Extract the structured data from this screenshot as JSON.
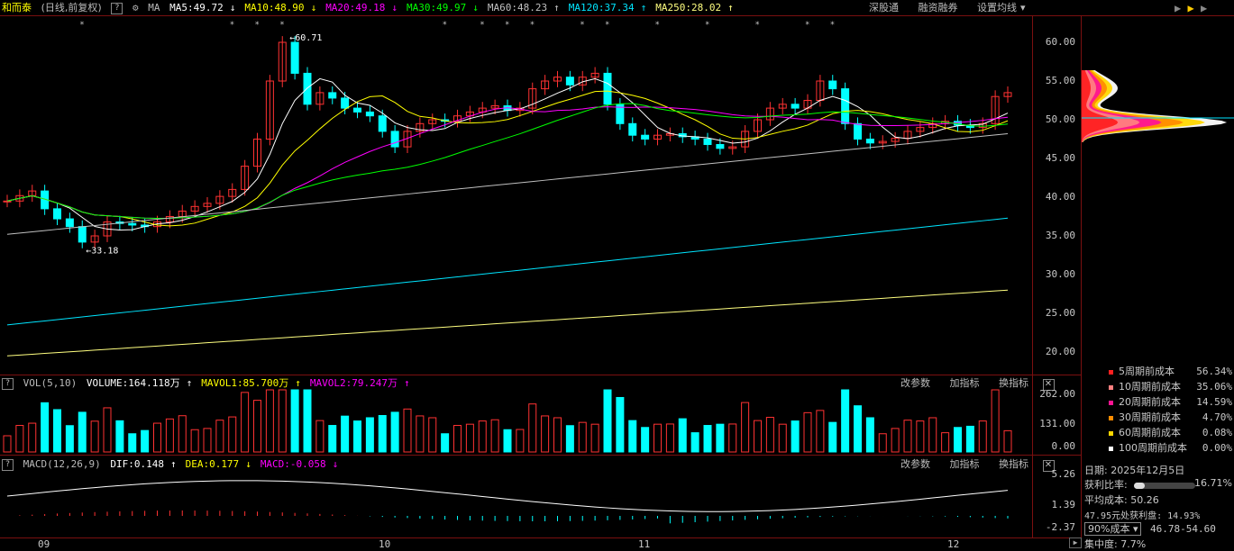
{
  "stock": {
    "name": "和而泰",
    "mode": "(日线,前复权)",
    "help": "?",
    "ma_label": "MA"
  },
  "ma_items": [
    {
      "label": "MA5:49.72",
      "arrow": "↓",
      "color": "#ffffff"
    },
    {
      "label": "MA10:48.90",
      "arrow": "↓",
      "color": "#ffff00"
    },
    {
      "label": "MA20:49.18",
      "arrow": "↓",
      "color": "#ff00ff"
    },
    {
      "label": "MA30:49.97",
      "arrow": "↓",
      "color": "#00ff00"
    },
    {
      "label": "MA60:48.23",
      "arrow": "↑",
      "color": "#c0c0c0"
    },
    {
      "label": "MA120:37.34",
      "arrow": "↑",
      "color": "#00e5ff"
    },
    {
      "label": "MA250:28.02",
      "arrow": "↑",
      "color": "#ffff80"
    }
  ],
  "top_buttons": [
    "深股通",
    "融资融券",
    "设置均线"
  ],
  "dropdown_arrow": "▾",
  "price_axis": [
    "60.00",
    "55.00",
    "50.00",
    "45.00",
    "40.00",
    "35.00",
    "30.00",
    "25.00",
    "20.00"
  ],
  "annotations": {
    "high": "60.71",
    "low": "33.18"
  },
  "vol": {
    "name": "VOL(5,10)",
    "items": [
      {
        "label": "VOLUME:164.118万",
        "arrow": "↑",
        "color": "#ffffff"
      },
      {
        "label": "MAVOL1:85.700万",
        "arrow": "↑",
        "color": "#ffff00"
      },
      {
        "label": "MAVOL2:79.247万",
        "arrow": "↑",
        "color": "#ff00ff"
      }
    ],
    "axis": [
      "262.00",
      "131.00",
      "0.00"
    ]
  },
  "macd": {
    "name": "MACD(12,26,9)",
    "items": [
      {
        "label": "DIF:0.148",
        "arrow": "↑",
        "color": "#ffffff"
      },
      {
        "label": "DEA:0.177",
        "arrow": "↓",
        "color": "#ffff00"
      },
      {
        "label": "MACD:-0.058",
        "arrow": "↓",
        "color": "#ff00ff"
      }
    ],
    "axis": [
      "5.26",
      "1.39",
      "-2.37"
    ]
  },
  "panel_buttons": [
    "改参数",
    "加指标",
    "换指标"
  ],
  "close_label": "✕",
  "x_axis": [
    {
      "label": "09"
    },
    {
      "label": "10"
    },
    {
      "label": "11"
    },
    {
      "label": "12"
    }
  ],
  "cost_legend": [
    {
      "label": "5周期前成本",
      "pct": "56.34%",
      "color": "#ff2020"
    },
    {
      "label": "10周期前成本",
      "pct": "35.06%",
      "color": "#ff8080"
    },
    {
      "label": "20周期前成本",
      "pct": "14.59%",
      "color": "#ff1493"
    },
    {
      "label": "30周期前成本",
      "pct": "4.70%",
      "color": "#ff8c00"
    },
    {
      "label": "60周期前成本",
      "pct": "0.08%",
      "color": "#ffd700"
    },
    {
      "label": "100周期前成本",
      "pct": "0.00%",
      "color": "#ffffff"
    }
  ],
  "cost_info": {
    "date": "日期: 2025年12月5日",
    "profit_label": "获利比率:",
    "profit_value": "16.71%",
    "profit_fraction": 0.1671,
    "avg_cost": "平均成本: 50.26",
    "profit_at": "47.95元处获利盘: 14.93%",
    "cost_select": "90%成本",
    "cost_range": "46.78-54.60",
    "concentration": "集中度: 7.7%"
  }
}
